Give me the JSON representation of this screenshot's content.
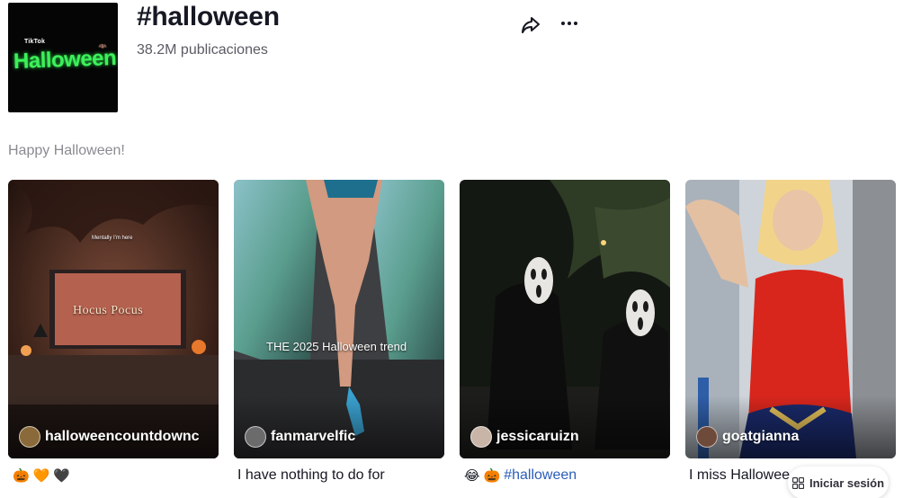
{
  "header": {
    "cover_brand": "TikTok",
    "cover_title": "Halloween",
    "title": "#halloween",
    "posts_count": "38.2M publicaciones"
  },
  "description": "Happy Halloween!",
  "videos": [
    {
      "username": "halloweencountdownc",
      "overlay_text": "Mentally I'm here",
      "tv_text": "Hocus Pocus",
      "caption": "",
      "caption_emojis": [
        "🎃",
        "🧡",
        "🖤"
      ]
    },
    {
      "username": "fanmarvelfic",
      "overlay_text": "THE 2025 Halloween trend",
      "caption": "I have nothing to do for"
    },
    {
      "username": "jessicaruizn",
      "caption_emojis": [
        "😂",
        "🎃"
      ],
      "caption_hashtag": "#halloween"
    },
    {
      "username": "goatgianna",
      "caption": "I miss Hallowee"
    }
  ],
  "login_button": {
    "label": "Iniciar sesión"
  },
  "icons": {
    "share": "share-icon",
    "more": "more-icon",
    "grid": "grid-icon"
  }
}
